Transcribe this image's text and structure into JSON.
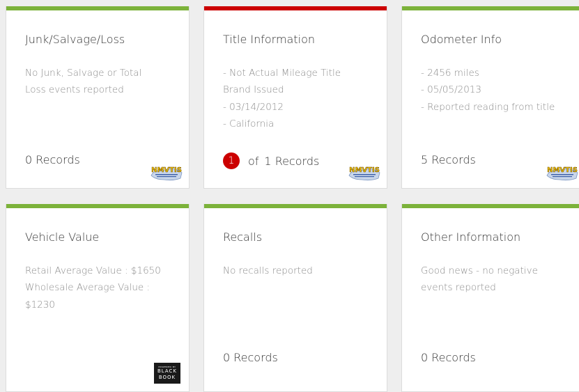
{
  "colors": {
    "green": "#7cb23a",
    "red": "#cc0000"
  },
  "cards": [
    {
      "title": "Junk/Salvage/Loss",
      "lines": [
        "No Junk, Salvage or Total Loss events reported"
      ],
      "records": "0 Records",
      "logo": "nmvtis-logo"
    },
    {
      "title": "Title Information",
      "lines": [
        "- Not Actual Mileage Title Brand Issued",
        "- 03/14/2012",
        "- California"
      ],
      "records_badge": "1",
      "records_of": "of",
      "records": "1 Records",
      "logo": "nmvtis-logo"
    },
    {
      "title": "Odometer Info",
      "lines": [
        "- 2456 miles",
        "- 05/05/2013",
        "- Reported reading from title"
      ],
      "records": "5 Records",
      "logo": "nmvtis-logo"
    },
    {
      "title": "Vehicle Value",
      "lines": [
        "Retail Average Value : $1650",
        "Wholesale Average Value : $1230"
      ],
      "logo": "blackbook-logo",
      "logo_text": [
        "POWERED BY",
        "BLACK",
        "BOOK"
      ]
    },
    {
      "title": "Recalls",
      "lines": [
        "No recalls reported"
      ],
      "records": "0 Records"
    },
    {
      "title": "Other Information",
      "lines": [
        "Good news - no negative events reported"
      ],
      "records": "0 Records"
    }
  ],
  "nmvtis": {
    "brand": "NMVTIS",
    "tagline": "National Motor Vehicle Title Information System"
  }
}
